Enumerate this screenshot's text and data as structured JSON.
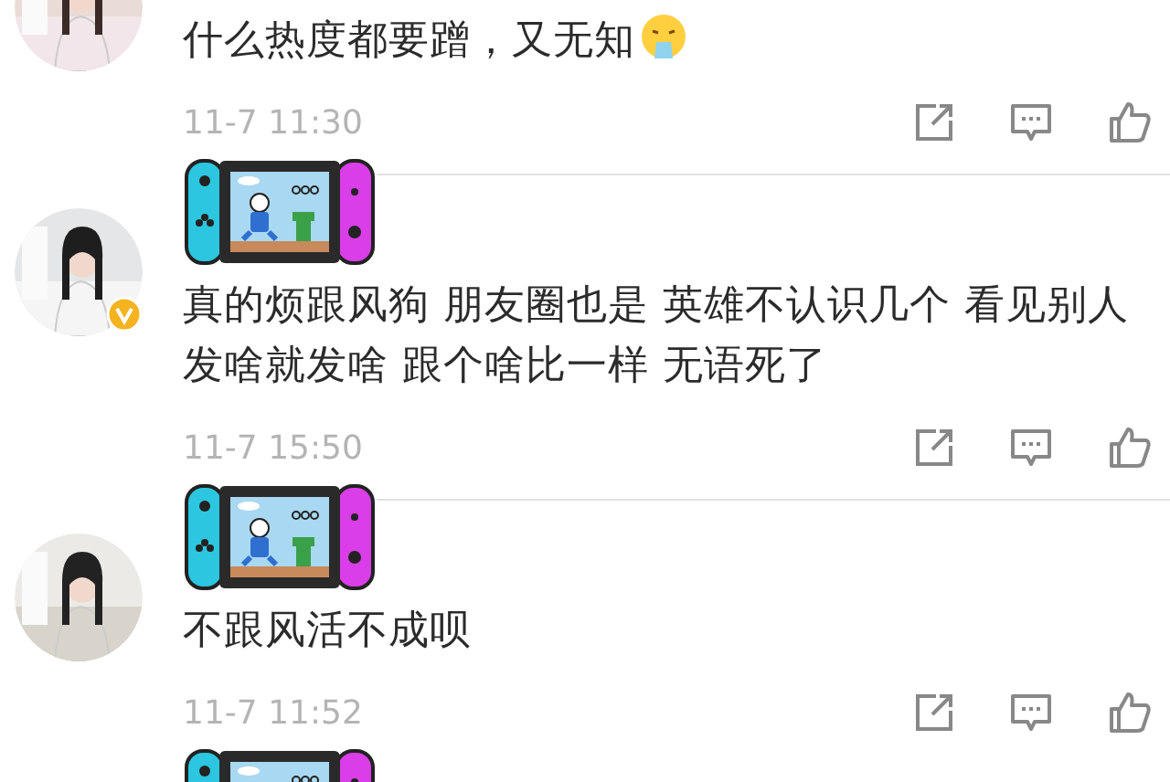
{
  "comments": [
    {
      "text": "什么热度都要蹭，又无知",
      "emoji": true,
      "verified": false,
      "time": "11-7 11:30"
    },
    {
      "text": "真的烦跟风狗 朋友圈也是 英雄不认识几个 看见别人发啥就发啥 跟个啥比一样 无语死了",
      "emoji": false,
      "verified": true,
      "time": "11-7 15:50"
    },
    {
      "text": "不跟风活不成呗",
      "emoji": false,
      "verified": false,
      "time": "11-7 11:52"
    }
  ]
}
